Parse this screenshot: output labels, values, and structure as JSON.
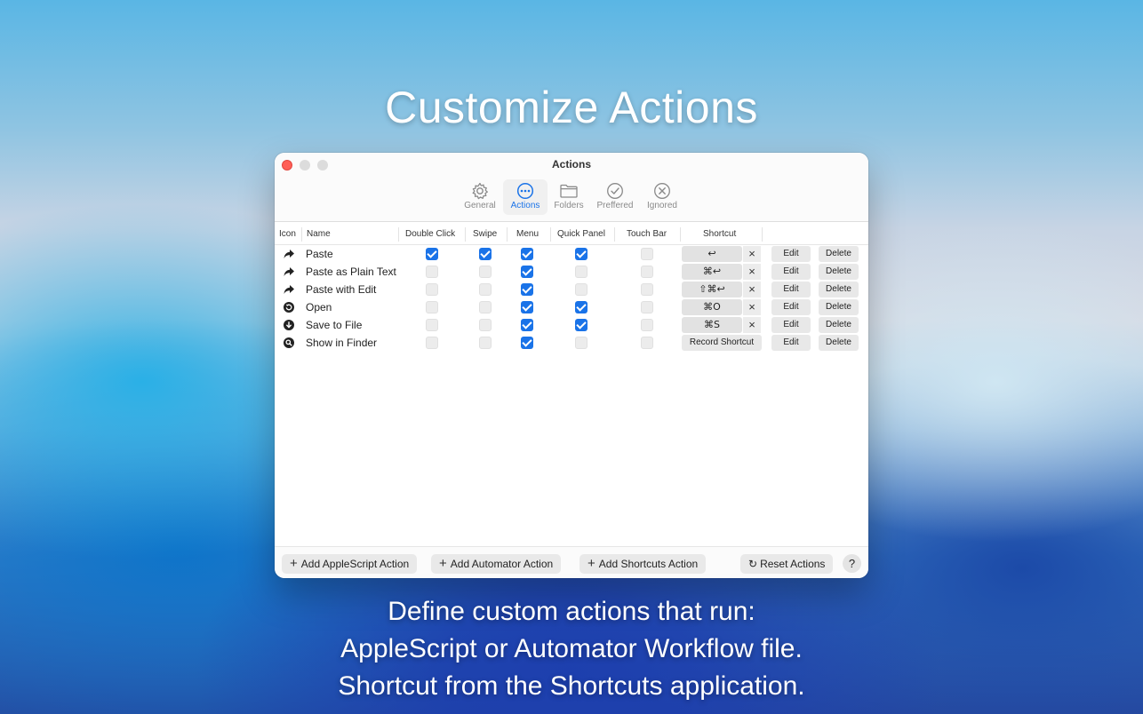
{
  "headline": "Customize Actions",
  "caption": [
    "Define custom actions that run:",
    "AppleScript or Automator Workflow file.",
    "Shortcut from the Shortcuts application."
  ],
  "window": {
    "title": "Actions",
    "tabs": [
      {
        "label": "General",
        "icon": "gear-icon"
      },
      {
        "label": "Actions",
        "icon": "ellipsis-circle-icon",
        "active": true
      },
      {
        "label": "Folders",
        "icon": "folder-icon"
      },
      {
        "label": "Preffered",
        "icon": "checkmark-circle-icon"
      },
      {
        "label": "Ignored",
        "icon": "x-circle-icon"
      }
    ]
  },
  "table": {
    "headers": {
      "icon": "Icon",
      "name": "Name",
      "double_click": "Double Click",
      "swipe": "Swipe",
      "menu": "Menu",
      "quick_panel": "Quick Panel",
      "touch_bar": "Touch Bar",
      "shortcut": "Shortcut"
    },
    "rows": [
      {
        "name": "Paste",
        "icon": "share-arrow-icon",
        "double_click": true,
        "swipe": true,
        "menu": true,
        "quick_panel": true,
        "touch_bar": false,
        "shortcut": "↩"
      },
      {
        "name": "Paste as Plain Text",
        "icon": "share-arrow-icon",
        "double_click": false,
        "swipe": false,
        "menu": true,
        "quick_panel": false,
        "touch_bar": false,
        "shortcut": "⌘↩"
      },
      {
        "name": "Paste with Edit",
        "icon": "share-arrow-icon",
        "double_click": false,
        "swipe": false,
        "menu": true,
        "quick_panel": false,
        "touch_bar": false,
        "shortcut": "⇧⌘↩"
      },
      {
        "name": "Open",
        "icon": "open-circle-icon",
        "double_click": false,
        "swipe": false,
        "menu": true,
        "quick_panel": true,
        "touch_bar": false,
        "shortcut": "⌘O"
      },
      {
        "name": "Save to File",
        "icon": "download-circle-icon",
        "double_click": false,
        "swipe": false,
        "menu": true,
        "quick_panel": true,
        "touch_bar": false,
        "shortcut": "⌘S"
      },
      {
        "name": "Show in Finder",
        "icon": "magnifier-circle-icon",
        "double_click": false,
        "swipe": false,
        "menu": true,
        "quick_panel": false,
        "touch_bar": false,
        "shortcut": ""
      }
    ],
    "clear_glyph": "×",
    "record_label": "Record Shortcut",
    "edit_label": "Edit",
    "delete_label": "Delete"
  },
  "bottom": {
    "plus_glyph": "+",
    "add_applescript": "Add AppleScript Action",
    "add_automator": "Add Automator Action",
    "add_shortcuts": "Add Shortcuts Action",
    "reset_icon": "↻",
    "reset": "Reset Actions",
    "help": "?"
  },
  "colors": {
    "accent": "#1a73e8",
    "close": "#ff5f57"
  }
}
